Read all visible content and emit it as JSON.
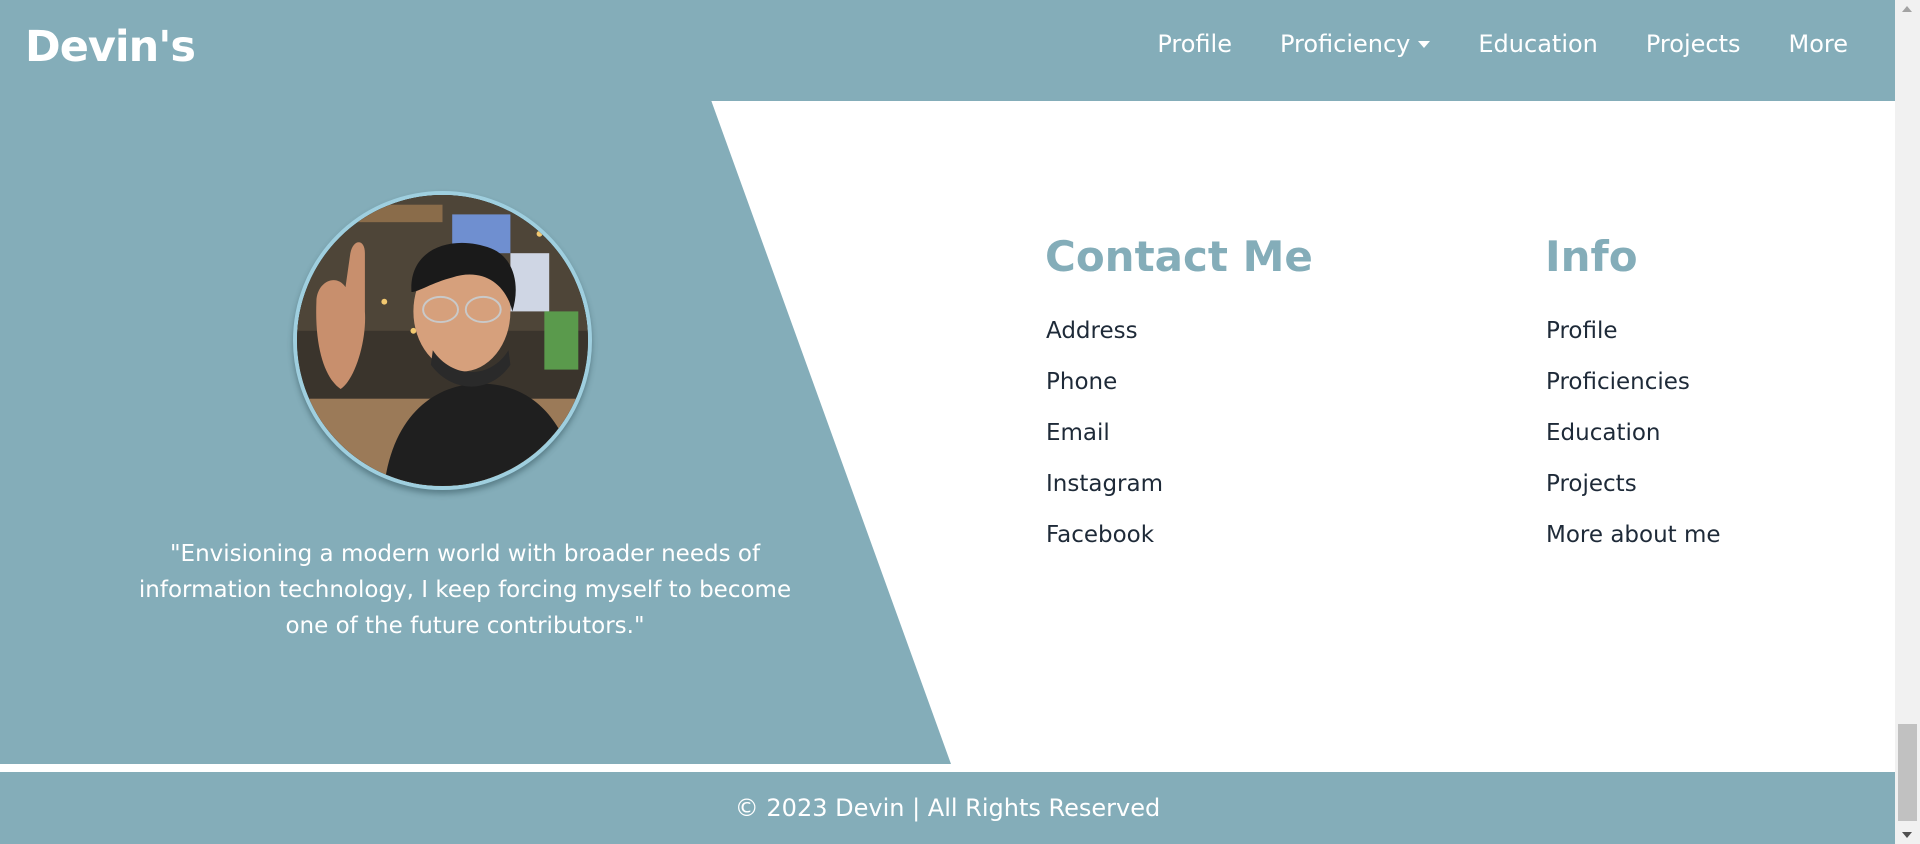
{
  "navbar": {
    "brand": "Devin's",
    "links": [
      {
        "label": "Profile"
      },
      {
        "label": "Proficiency",
        "has_dropdown": true
      },
      {
        "label": "Education"
      },
      {
        "label": "Projects"
      },
      {
        "label": "More"
      }
    ]
  },
  "hero": {
    "quote": "\"Envisioning a modern world with broader needs of information technology, I keep forcing myself to become one of the future contributors.\""
  },
  "contact": {
    "title": "Contact Me",
    "items": [
      "Address",
      "Phone",
      "Email",
      "Instagram",
      "Facebook"
    ]
  },
  "info": {
    "title": "Info",
    "items": [
      "Profile",
      "Proficiencies",
      "Education",
      "Projects",
      "More about me"
    ]
  },
  "footer": {
    "text": "© 2023 Devin | All Rights Reserved"
  },
  "colors": {
    "accent": "#84adb9",
    "text_dark": "#1e2a38",
    "photo_border": "#9fcfdf"
  }
}
